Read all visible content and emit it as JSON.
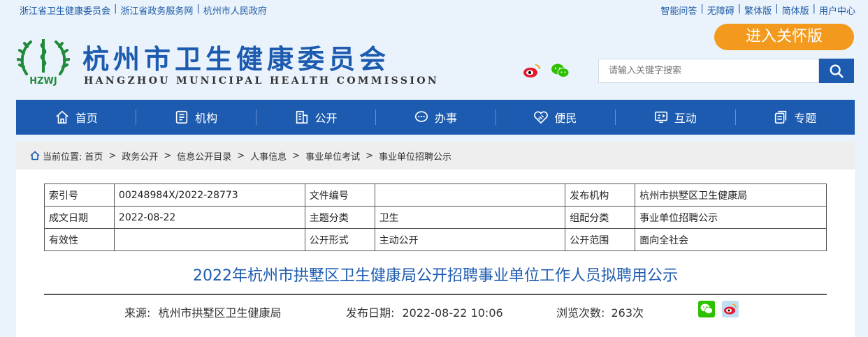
{
  "topbar": {
    "left_links": [
      "浙江省卫生健康委员会",
      "浙江省政务服务网",
      "杭州市人民政府"
    ],
    "right_links": [
      "智能问答",
      "无障碍",
      "繁体版",
      "简体版",
      "用户中心"
    ],
    "separator": "|"
  },
  "header": {
    "logo_text": "HZWJ",
    "title_cn": "杭州市卫生健康委员会",
    "title_en": "HANGZHOU MUNICIPAL HEALTH COMMISSION",
    "care_button": "进入关怀版",
    "search_placeholder": "请输入关键字搜索"
  },
  "nav": {
    "items": [
      {
        "label": "首页",
        "icon": "home-icon"
      },
      {
        "label": "机构",
        "icon": "org-icon"
      },
      {
        "label": "公开",
        "icon": "building-icon"
      },
      {
        "label": "办事",
        "icon": "chat-icon"
      },
      {
        "label": "便民",
        "icon": "handshake-icon"
      },
      {
        "label": "互动",
        "icon": "interact-icon"
      },
      {
        "label": "专题",
        "icon": "topic-icon"
      }
    ]
  },
  "breadcrumb": {
    "prefix": "当前位置:",
    "items": [
      "首页",
      "政务公开",
      "信息公开目录",
      "人事信息",
      "事业单位考试",
      "事业单位招聘公示"
    ],
    "separator": ">"
  },
  "meta_table": {
    "rows": [
      [
        "索引号",
        "00248984X/2022-28773",
        "文件编号",
        "",
        "发布机构",
        "杭州市拱墅区卫生健康局"
      ],
      [
        "成文日期",
        "2022-08-22",
        "主题分类",
        "卫生",
        "组配分类",
        "事业单位招聘公示"
      ],
      [
        "有效性",
        "",
        "公开形式",
        "主动公开",
        "公开范围",
        "面向全社会"
      ]
    ]
  },
  "article": {
    "title": "2022年杭州市拱墅区卫生健康局公开招聘事业单位工作人员拟聘用公示",
    "source_label": "来源:",
    "source": "杭州市拱墅区卫生健康局",
    "date_label": "发布日期:",
    "date": "2022-08-22 10:06",
    "views_label": "浏览次数:",
    "views": "263次"
  },
  "colors": {
    "brand_blue": "#1c5bb0",
    "care_orange": "#f39a1e",
    "page_bg": "#eaf3fb"
  }
}
